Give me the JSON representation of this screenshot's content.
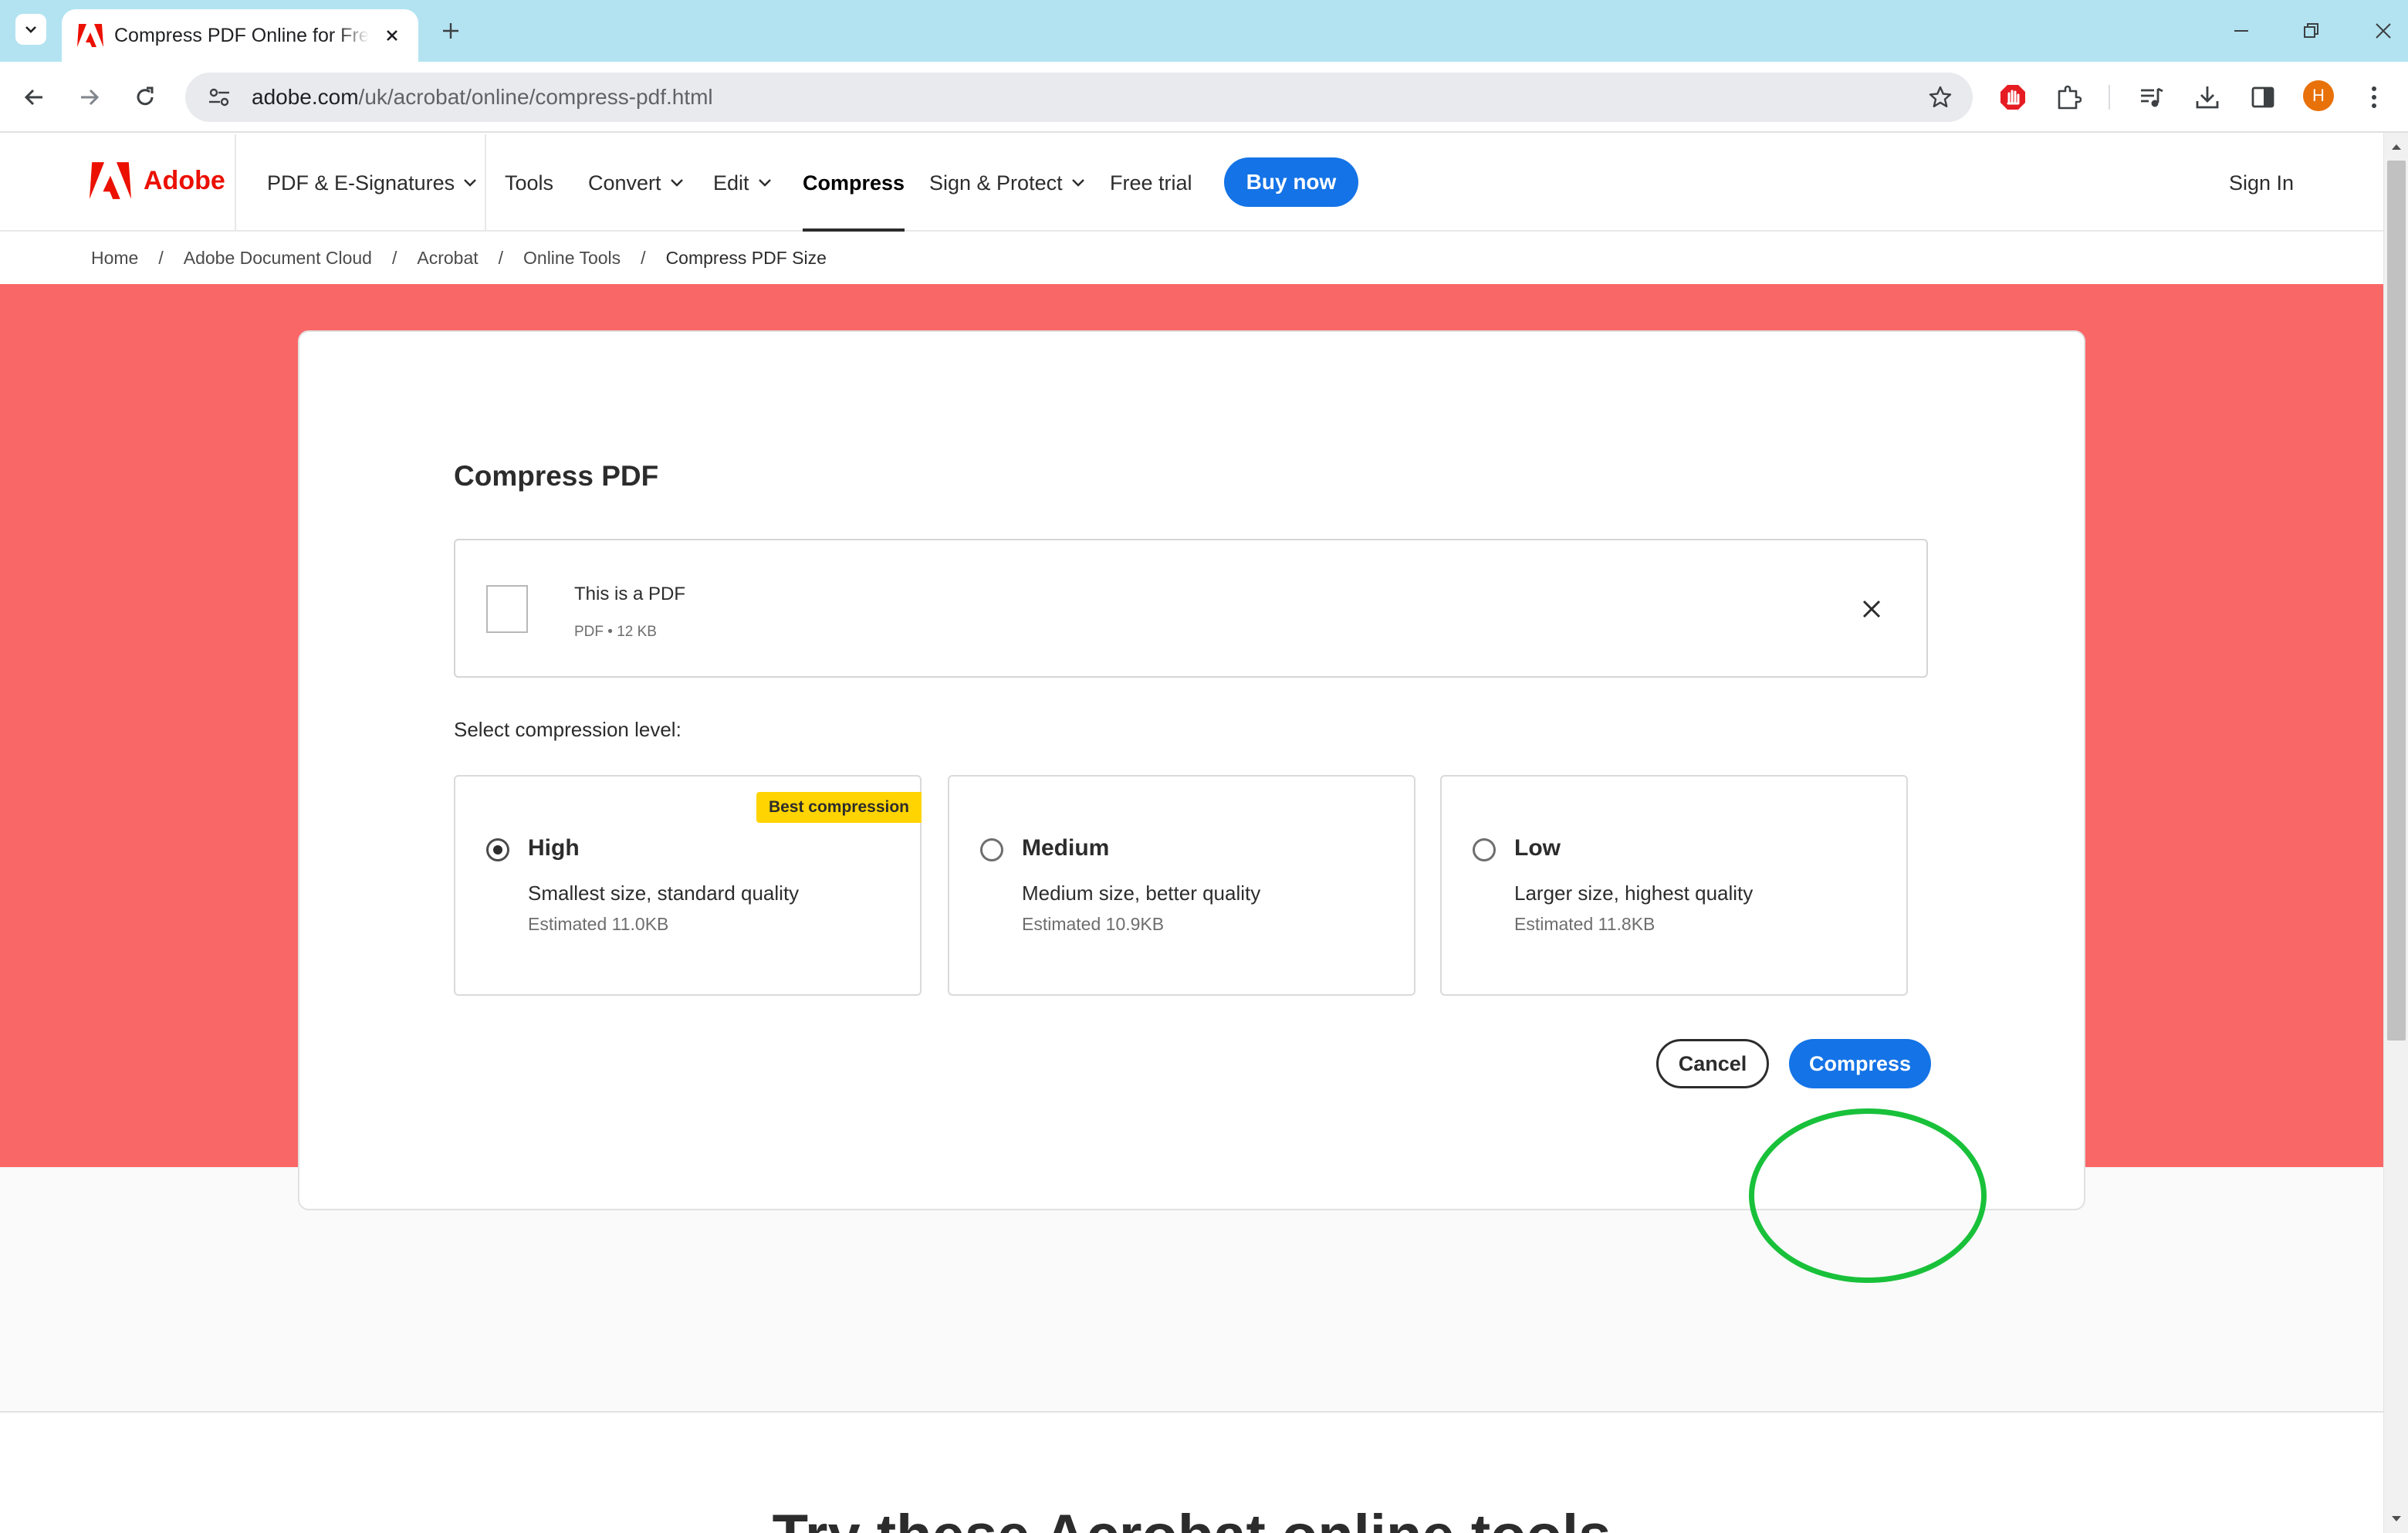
{
  "browser": {
    "tab_title": "Compress PDF Online for Free | Adobe Acrobat",
    "url_host": "adobe.com",
    "url_path": "/uk/acrobat/online/compress-pdf.html",
    "profile_initial": "H",
    "colors": {
      "tabstrip": "#b3e3f1",
      "omnibox": "#e8eaed",
      "profile": "#e8710a"
    }
  },
  "nav": {
    "brand": "Adobe",
    "items": [
      "PDF & E-Signatures",
      "Tools",
      "Convert",
      "Edit",
      "Compress",
      "Sign & Protect",
      "Free trial"
    ],
    "active": "Compress",
    "buy_now": "Buy now",
    "sign_in": "Sign In"
  },
  "breadcrumb": [
    "Home",
    "Adobe Document Cloud",
    "Acrobat",
    "Online Tools",
    "Compress PDF Size"
  ],
  "dialog": {
    "title": "Compress PDF",
    "file": {
      "name": "This is a PDF",
      "meta": "PDF • 12 KB"
    },
    "select_label": "Select compression level:",
    "options": [
      {
        "title": "High",
        "desc": "Smallest size, standard quality",
        "estimate": "Estimated 11.0KB",
        "badge": "Best compression",
        "selected": true
      },
      {
        "title": "Medium",
        "desc": "Medium size, better quality",
        "estimate": "Estimated 10.9KB",
        "selected": false
      },
      {
        "title": "Low",
        "desc": "Larger size, highest quality",
        "estimate": "Estimated 11.8KB",
        "selected": false
      }
    ],
    "cancel": "Cancel",
    "compress": "Compress"
  },
  "lower_heading": "Try these Acrobat online tools",
  "colors": {
    "hero": "#fa6767",
    "accent": "#1473e6",
    "brand_red": "#eb1000",
    "badge": "#ffd400",
    "annotation_ring": "#19c13a"
  },
  "icons": [
    "tab-list-icon",
    "adobe-favicon-icon",
    "close-icon",
    "plus-icon",
    "minimize-icon",
    "restore-icon",
    "back-icon",
    "forward-icon",
    "reload-icon",
    "site-info-icon",
    "star-icon",
    "extension-icon",
    "puzzle-icon",
    "media-icon",
    "download-icon",
    "side-panel-icon",
    "kebab-menu-icon"
  ]
}
